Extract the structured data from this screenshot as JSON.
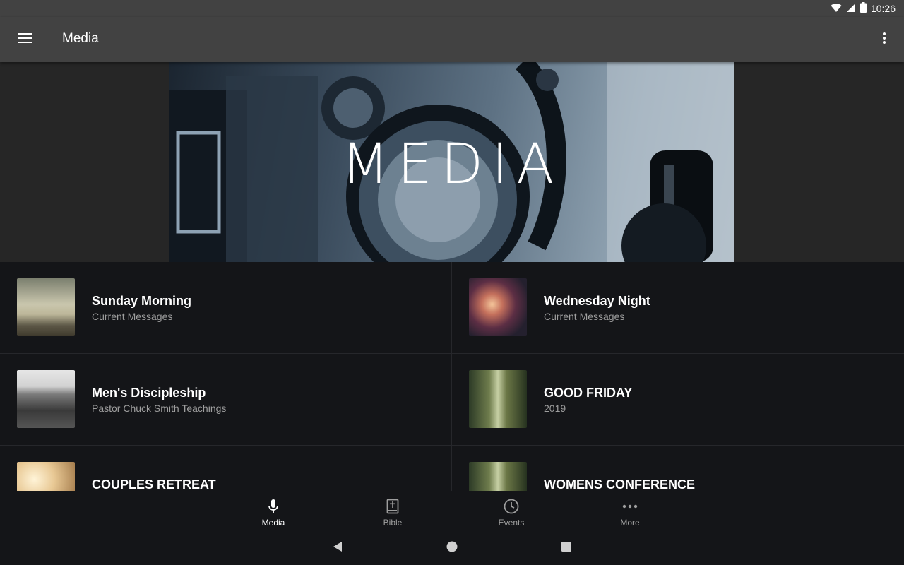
{
  "status": {
    "time": "10:26"
  },
  "appbar": {
    "title": "Media"
  },
  "hero": {
    "text": "MEDIA"
  },
  "items": [
    {
      "title": "Sunday Morning",
      "subtitle": "Current Messages"
    },
    {
      "title": "Wednesday Night",
      "subtitle": "Current Messages"
    },
    {
      "title": "Men's Discipleship",
      "subtitle": "Pastor Chuck Smith Teachings"
    },
    {
      "title": "GOOD FRIDAY",
      "subtitle": "2019"
    },
    {
      "title": "COUPLES RETREAT",
      "subtitle": ""
    },
    {
      "title": "WOMENS CONFERENCE",
      "subtitle": ""
    }
  ],
  "bottom_nav": [
    {
      "label": "Media",
      "icon": "microphone-icon",
      "active": true
    },
    {
      "label": "Bible",
      "icon": "bible-icon",
      "active": false
    },
    {
      "label": "Events",
      "icon": "clock-icon",
      "active": false
    },
    {
      "label": "More",
      "icon": "more-horizontal-icon",
      "active": false
    }
  ],
  "colors": {
    "appbar": "#424242",
    "background": "#141518",
    "active": "#ffffff",
    "inactive": "#9e9e9e"
  }
}
